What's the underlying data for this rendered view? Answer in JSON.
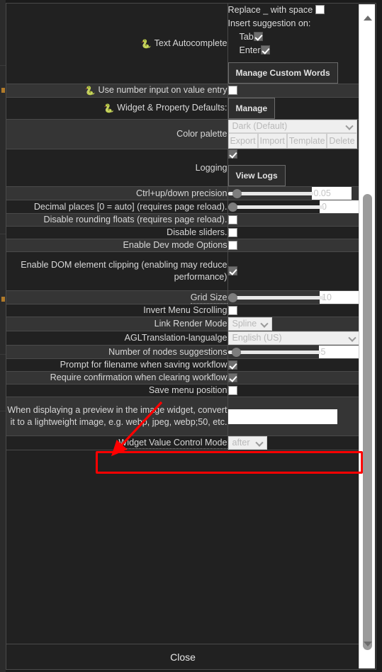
{
  "dialog": {
    "close_label": "Close"
  },
  "annotation": {
    "highlight_color": "#ff0000",
    "arrow_color": "#ff0000",
    "highlighted_row": "AGLTranslation-langualge"
  },
  "scrollbar": {
    "up_arrow": "triangle-up-icon",
    "down_arrow": "triangle-down-icon"
  },
  "rows": [
    {
      "id": "text-autocomplete",
      "icon": "snake-icon",
      "label": "Text Autocomplete",
      "type": "autocomplete",
      "replace_label": "Replace _ with space",
      "replace_checked": false,
      "insert_label": "Insert suggestion on:",
      "tab_label": "Tab",
      "tab_checked": true,
      "enter_label": "Enter",
      "enter_checked": true,
      "button_label": "Manage Custom Words"
    },
    {
      "id": "use-number-input",
      "icon": "snake-icon",
      "label": "Use number input on value entry",
      "type": "checkbox",
      "checked": false
    },
    {
      "id": "widget-property-defaults",
      "icon": "snake-icon",
      "label": "Widget & Property Defaults:",
      "type": "button",
      "button_label": "Manage"
    },
    {
      "id": "color-palette",
      "label": "Color palette",
      "type": "palette",
      "selected": "Dark (Default)",
      "buttons": [
        "Export",
        "Import",
        "Template",
        "Delete"
      ]
    },
    {
      "id": "logging",
      "label": "Logging",
      "type": "checkbox-button",
      "checked": true,
      "button_label": "View Logs"
    },
    {
      "id": "ctrl-precision",
      "label": "Ctrl+up/down precision",
      "type": "slider",
      "value": "0.05",
      "thumb_pct": 6
    },
    {
      "id": "decimal-places",
      "label": "Decimal places [0 = auto] (requires page reload).",
      "type": "slider",
      "value": "0",
      "thumb_pct": 0
    },
    {
      "id": "disable-rounding-floats",
      "label": "Disable rounding floats (requires page reload).",
      "type": "checkbox",
      "checked": false
    },
    {
      "id": "disable-sliders",
      "label": "Disable sliders.",
      "type": "checkbox",
      "checked": false
    },
    {
      "id": "enable-dev-mode",
      "label": "Enable Dev mode Options",
      "type": "checkbox",
      "checked": false
    },
    {
      "id": "enable-dom-clipping",
      "label": "Enable DOM element clipping (enabling may reduce performance)",
      "type": "checkbox",
      "checked": true
    },
    {
      "id": "grid-size",
      "label": "Grid Size",
      "dotted": true,
      "type": "slider",
      "value": "10",
      "thumb_pct": 0
    },
    {
      "id": "invert-menu-scrolling",
      "label": "Invert Menu Scrolling",
      "type": "checkbox",
      "checked": false
    },
    {
      "id": "link-render-mode",
      "label": "Link Render Mode",
      "type": "select-small",
      "selected": "Spline"
    },
    {
      "id": "agl-translation-language",
      "label": "AGLTranslation-langualge",
      "type": "select-lang",
      "selected": "English (US)",
      "highlighted": true
    },
    {
      "id": "number-of-nodes-suggestions",
      "label": "Number of nodes suggestions",
      "type": "slider",
      "value": "5",
      "thumb_pct": 5
    },
    {
      "id": "prompt-filename-saving",
      "label": "Prompt for filename when saving workflow",
      "type": "checkbox",
      "checked": true
    },
    {
      "id": "require-confirmation-clearing",
      "label": "Require confirmation when clearing workflow",
      "type": "checkbox",
      "checked": true
    },
    {
      "id": "save-menu-position",
      "label": "Save menu position",
      "type": "checkbox",
      "checked": false
    },
    {
      "id": "preview-lightweight-image",
      "label": "When displaying a preview in the image widget, convert it to a lightweight image, e.g. webp, jpeg, webp;50, etc.",
      "type": "text",
      "value": ""
    },
    {
      "id": "widget-value-control-mode",
      "label": "Widget Value Control Mode",
      "dotted": true,
      "type": "select-tiny",
      "selected": "after"
    }
  ]
}
